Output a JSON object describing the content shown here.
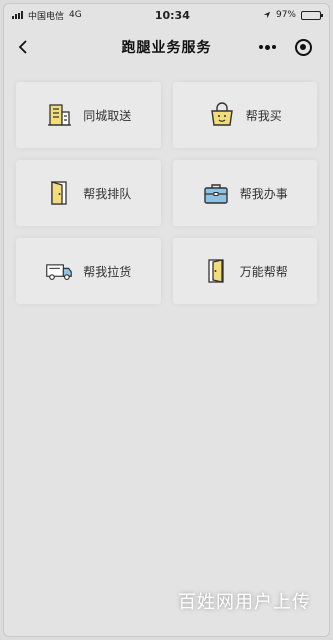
{
  "status_bar": {
    "carrier": "中国电信",
    "network": "4G",
    "time": "10:34",
    "battery": "97%",
    "battery_level": 0.97
  },
  "nav": {
    "title": "跑腿业务服务"
  },
  "services": [
    {
      "label": "同城取送",
      "icon": "building-icon"
    },
    {
      "label": "帮我买",
      "icon": "shopping-bag-icon"
    },
    {
      "label": "帮我排队",
      "icon": "door-icon"
    },
    {
      "label": "帮我办事",
      "icon": "briefcase-icon"
    },
    {
      "label": "帮我拉货",
      "icon": "truck-icon"
    },
    {
      "label": "万能帮帮",
      "icon": "open-door-icon"
    }
  ],
  "watermark": "百姓网用户上传",
  "colors": {
    "icon_yellow": "#f3dc7a",
    "icon_blue": "#8fc1e3",
    "icon_stroke": "#333333",
    "background": "#e3e3e3"
  }
}
